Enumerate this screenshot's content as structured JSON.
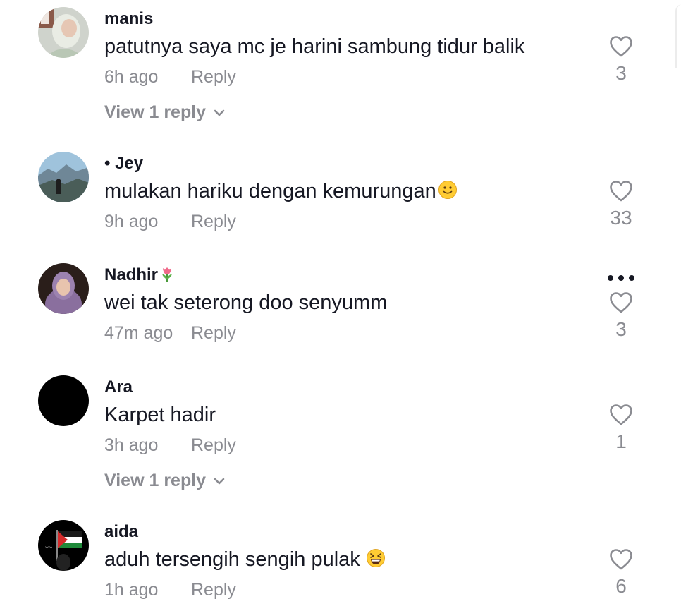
{
  "comments": [
    {
      "username": "manis",
      "text": "patutnya saya mc je harini sambung tidur balik",
      "time": "6h ago",
      "reply_label": "Reply",
      "likes": "3",
      "view_replies": "View 1 reply"
    },
    {
      "username": "• Jey",
      "text": "mulakan hariku dengan kemurungan",
      "text_emoji": "slightly-smiling-face",
      "time": "9h ago",
      "reply_label": "Reply",
      "likes": "33"
    },
    {
      "username": "Nadhir",
      "username_emoji": "tulip",
      "text": "wei tak seterong doo senyumm",
      "time": "47m ago",
      "reply_label": "Reply",
      "likes": "3",
      "has_more_menu": true
    },
    {
      "username": "Ara",
      "text": "Karpet hadir",
      "time": "3h ago",
      "reply_label": "Reply",
      "likes": "1",
      "view_replies": "View 1 reply"
    },
    {
      "username": "aida",
      "text": "aduh tersengih sengih pulak",
      "text_emoji": "grinning-squinting-face",
      "time": "1h ago",
      "reply_label": "Reply",
      "likes": "6"
    }
  ],
  "colors": {
    "primary_text": "#161823",
    "secondary_text": "#8a8b91",
    "background": "#ffffff"
  },
  "icons": {
    "like": "heart-outline-icon",
    "expand": "chevron-down-icon",
    "more": "more-horizontal-icon"
  }
}
